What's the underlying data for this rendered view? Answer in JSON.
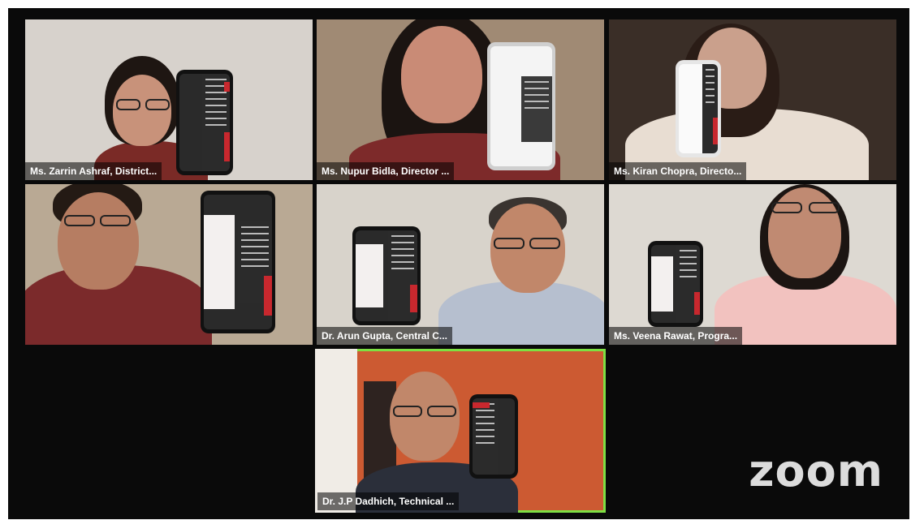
{
  "app": "Zoom",
  "logo_text": "zoom",
  "participants": [
    {
      "name": "Ms. Zarrin Ashraf, District..."
    },
    {
      "name": "Ms. Nupur Bidla, Director ..."
    },
    {
      "name": "Ms. Kiran Chopra, Directo..."
    },
    {
      "name": ""
    },
    {
      "name": "Dr. Arun Gupta, Central C..."
    },
    {
      "name": "Ms. Veena Rawat, Progra..."
    },
    {
      "name": "Dr. J.P Dadhich, Technical ...",
      "active_speaker": true
    }
  ],
  "colors": {
    "active_border": "#7ee043",
    "label_bg": "rgba(0,0,0,0.55)",
    "background": "#0a0a0a"
  }
}
